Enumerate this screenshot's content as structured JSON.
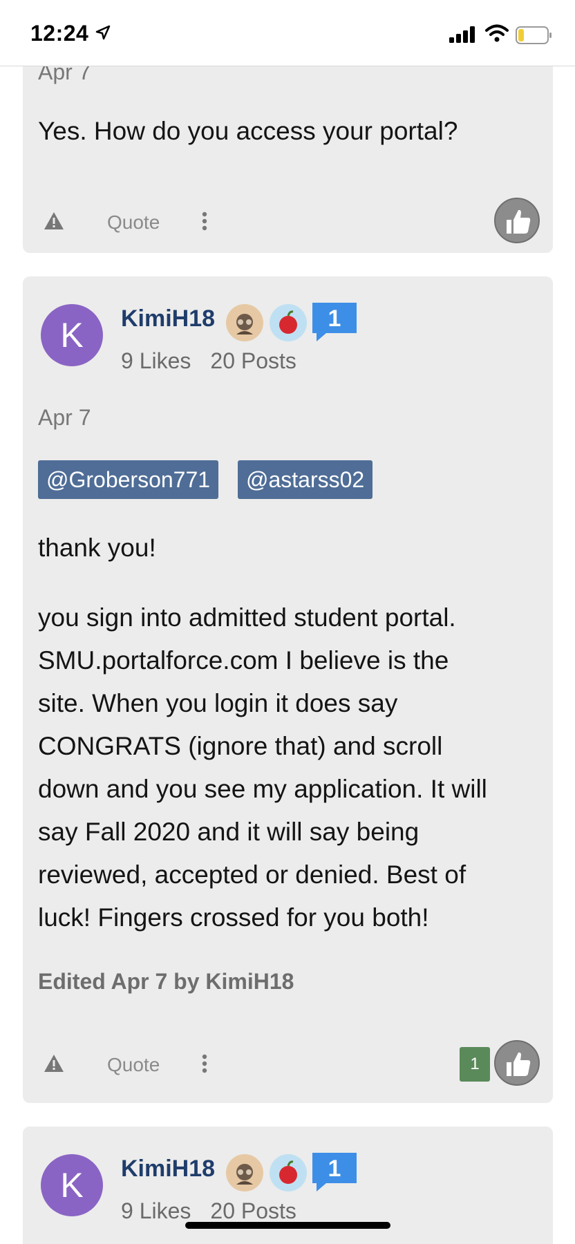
{
  "status_bar": {
    "time": "12:24"
  },
  "posts": [
    {
      "date_clipped": "Apr 7",
      "text": "Yes. How do you access your portal?",
      "actions": {
        "quote_label": "Quote"
      }
    },
    {
      "avatar_letter": "K",
      "username": "KimiH18",
      "rank_badge": "1",
      "likes": "9 Likes",
      "posts_count": "20 Posts",
      "date": "Apr 7",
      "mentions": [
        "@Groberson771",
        "@astarss02"
      ],
      "paragraphs": [
        "thank you!",
        [
          "you sign into admitted student portal.",
          "SMU.portalforce.com I believe is the",
          "site. When you login it does say",
          "CONGRATS (ignore that) and scroll",
          "down and you see my application. It will",
          "say Fall 2020 and it will say being",
          "reviewed, accepted or denied. Best of",
          "luck! Fingers crossed for you both!"
        ]
      ],
      "edited": "Edited Apr 7 by KimiH18",
      "actions": {
        "quote_label": "Quote",
        "like_count": "1"
      }
    },
    {
      "avatar_letter": "K",
      "username": "KimiH18",
      "rank_badge": "1",
      "likes": "9 Likes",
      "posts_count": "20 Posts"
    }
  ],
  "colors": {
    "card_bg": "#ececec",
    "username": "#1f3d6b",
    "mention_bg": "#4f6d96",
    "avatar_bg": "#8a64c4",
    "like_count_bg": "#5a8a5a"
  },
  "icons": [
    "location-arrow-icon",
    "signal-icon",
    "wifi-icon",
    "battery-icon",
    "report-icon",
    "more-icon",
    "thumbs-up-icon",
    "pilot-badge-icon",
    "apple-badge-icon",
    "rank-badge-icon"
  ]
}
